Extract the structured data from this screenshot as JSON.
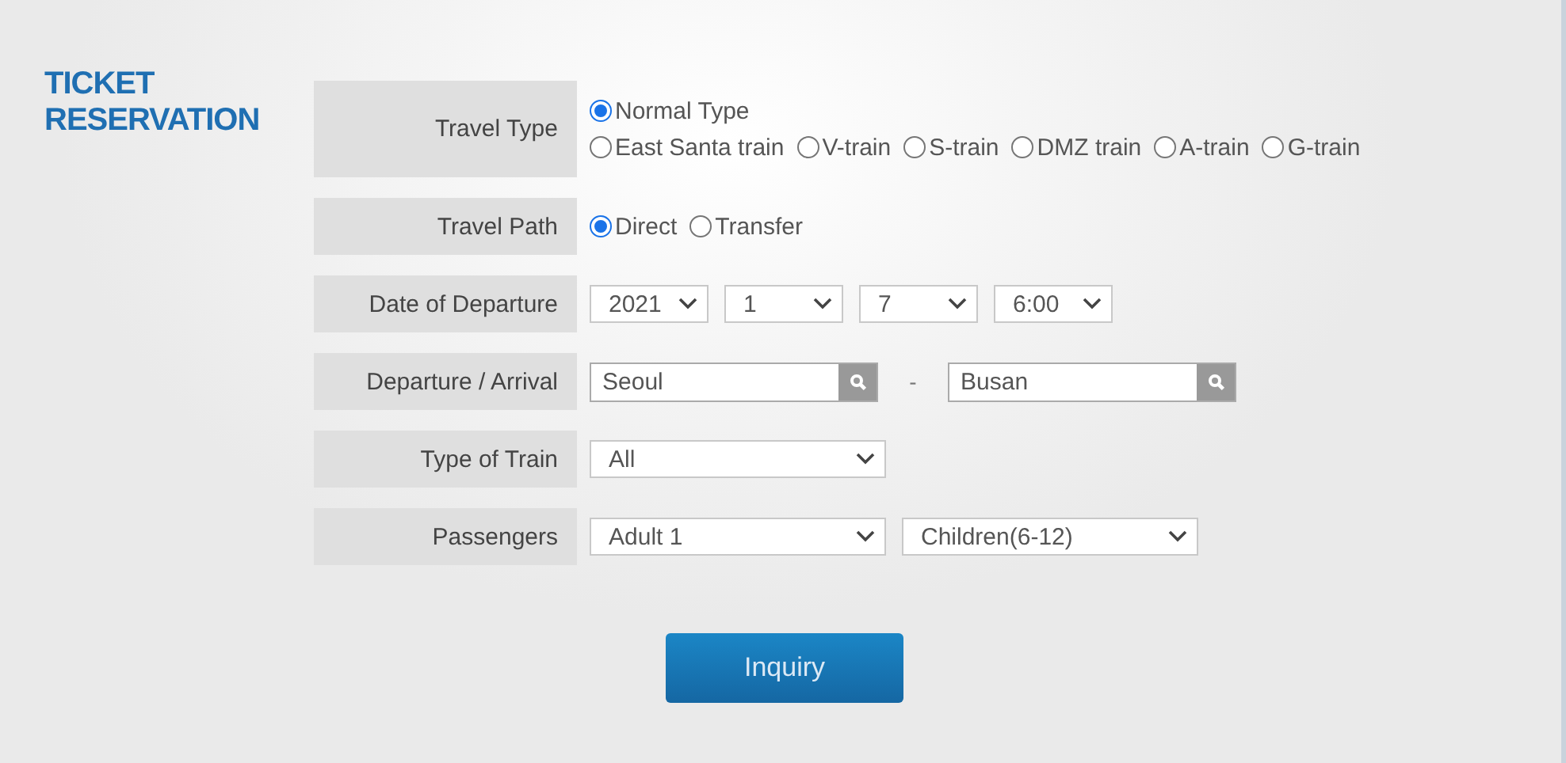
{
  "title": "TICKET RESERVATION",
  "rows": [
    {
      "kind": "radio",
      "label": "Travel Type",
      "lines": [
        [
          {
            "label": "Normal Type",
            "selected": true
          }
        ],
        [
          {
            "label": "East Santa train",
            "selected": false
          },
          {
            "label": "V-train",
            "selected": false
          },
          {
            "label": "S-train",
            "selected": false
          },
          {
            "label": "DMZ train",
            "selected": false
          },
          {
            "label": "A-train",
            "selected": false
          },
          {
            "label": "G-train",
            "selected": false
          }
        ]
      ]
    },
    {
      "kind": "radio",
      "label": "Travel Path",
      "lines": [
        [
          {
            "label": "Direct",
            "selected": true
          },
          {
            "label": "Transfer",
            "selected": false
          }
        ]
      ]
    },
    {
      "kind": "selects",
      "label": "Date of Departure",
      "selects": [
        {
          "value": "2021"
        },
        {
          "value": "1"
        },
        {
          "value": "7"
        },
        {
          "value": "6:00"
        }
      ]
    },
    {
      "kind": "route",
      "label": "Departure / Arrival",
      "from": "Seoul",
      "separator": "-",
      "to": "Busan"
    },
    {
      "kind": "selects",
      "label": "Type of Train",
      "selects": [
        {
          "value": "All"
        }
      ]
    },
    {
      "kind": "selects",
      "label": "Passengers",
      "selects": [
        {
          "value": "Adult 1"
        },
        {
          "value": "Children(6-12)"
        }
      ]
    }
  ],
  "button": "Inquiry"
}
